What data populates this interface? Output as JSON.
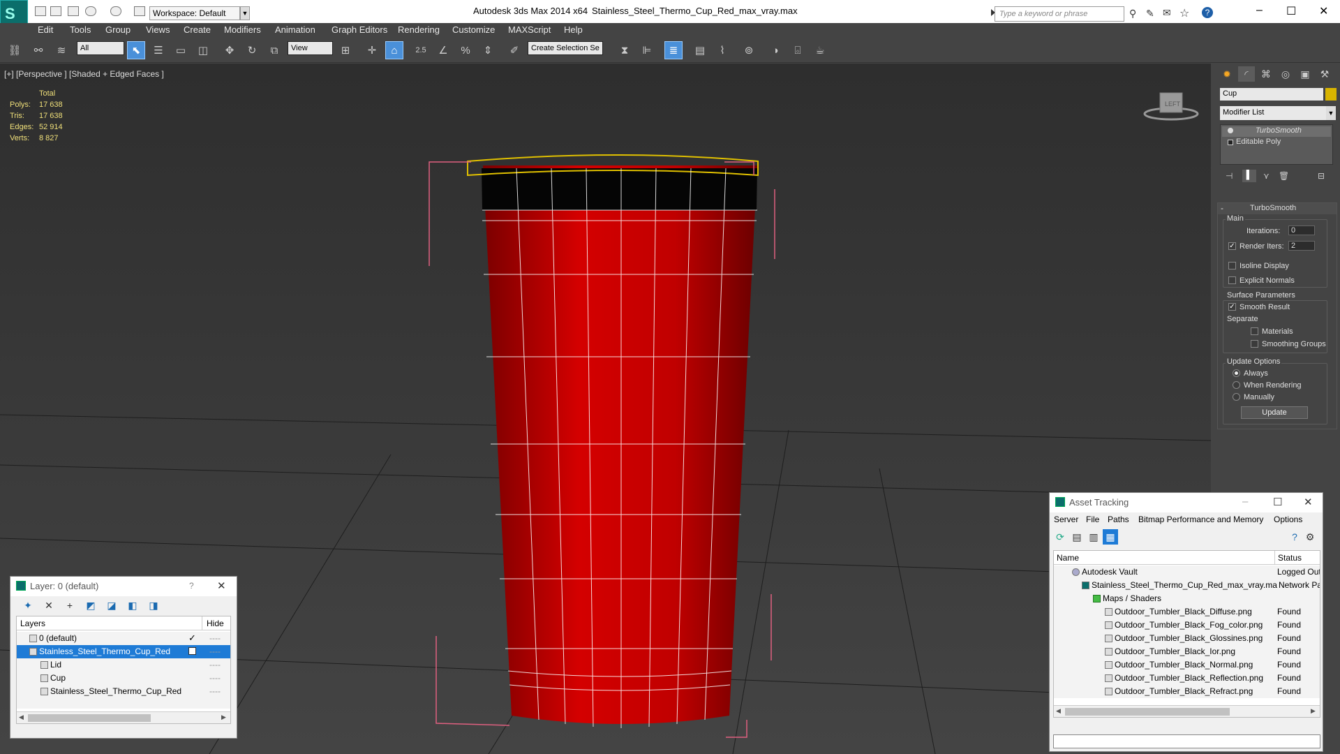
{
  "app": {
    "title": "Autodesk 3ds Max  2014 x64",
    "file": "Stainless_Steel_Thermo_Cup_Red_max_vray.max",
    "workspace": "Workspace: Default",
    "search_placeholder": "Type a keyword or phrase",
    "window_buttons": [
      "–",
      "☐",
      "✕"
    ]
  },
  "menu": [
    "Edit",
    "Tools",
    "Group",
    "Views",
    "Create",
    "Modifiers",
    "Animation",
    "Graph Editors",
    "Rendering",
    "Customize",
    "MAXScript",
    "Help"
  ],
  "toolbar": {
    "filter": "All",
    "ref_coord": "View",
    "snap_label": "2.5",
    "selection_set": "Create Selection Se"
  },
  "viewport": {
    "label": "[+] [Perspective ] [Shaded + Edged Faces ]",
    "stats_header": "Total",
    "stats": [
      {
        "label": "Polys:",
        "value": "17 638"
      },
      {
        "label": "Tris:",
        "value": "17 638"
      },
      {
        "label": "Edges:",
        "value": "52 914"
      },
      {
        "label": "Verts:",
        "value": "8 827"
      }
    ],
    "viewcube_label": "LEFT",
    "colors": {
      "background": "#3a3a3a",
      "cup": "#c80000",
      "wire": "#ffffff",
      "lid": "#e0c000",
      "bbox": "#e06080"
    }
  },
  "command_panel": {
    "object_name": "Cup",
    "object_color": "#d8b400",
    "modifier_list": "Modifier List",
    "stack": [
      {
        "label": "TurboSmooth",
        "selected": true
      },
      {
        "label": "Editable Poly",
        "selected": false
      }
    ],
    "rollout_title": "TurboSmooth",
    "main_group": "Main",
    "iterations_label": "Iterations:",
    "iterations_value": "0",
    "render_iters_label": "Render Iters:",
    "render_iters_value": "2",
    "render_iters_checked": "✓",
    "isoline_label": "Isoline Display",
    "explicit_normals_label": "Explicit Normals",
    "surface_group": "Surface Parameters",
    "smooth_result_label": "Smooth Result",
    "smooth_result_checked": "✓",
    "separate_label": "Separate",
    "materials_label": "Materials",
    "smoothing_groups_label": "Smoothing Groups",
    "update_group": "Update Options",
    "update_options": [
      "Always",
      "When Rendering",
      "Manually"
    ],
    "update_button": "Update",
    "collapse_symbol": "-"
  },
  "layer_window": {
    "title": "Layer: 0 (default)",
    "help": "?",
    "close": "✕",
    "col_layers": "Layers",
    "col_hide": "Hide",
    "rows": [
      {
        "label": "0 (default)",
        "indent": 0,
        "selected": false,
        "hide": "----",
        "check": "✓"
      },
      {
        "label": "Stainless_Steel_Thermo_Cup_Red",
        "indent": 0,
        "selected": true,
        "hide": "----",
        "check": ""
      },
      {
        "label": "Lid",
        "indent": 1,
        "selected": false,
        "hide": "----",
        "check": ""
      },
      {
        "label": "Cup",
        "indent": 1,
        "selected": false,
        "hide": "----",
        "check": ""
      },
      {
        "label": "Stainless_Steel_Thermo_Cup_Red",
        "indent": 1,
        "selected": false,
        "hide": "----",
        "check": ""
      }
    ],
    "scroll_left": "◀",
    "scroll_right": "▶"
  },
  "asset_window": {
    "title": "Asset Tracking",
    "window_buttons": [
      "–",
      "☐",
      "✕"
    ],
    "menu": [
      "Server",
      "File",
      "Paths",
      "Bitmap Performance and Memory",
      "Options"
    ],
    "col_name": "Name",
    "col_status": "Status",
    "rows": [
      {
        "name": "Autodesk Vault",
        "status": "Logged Out",
        "indent": 1
      },
      {
        "name": "Stainless_Steel_Thermo_Cup_Red_max_vray.max",
        "status": "Network Pat",
        "indent": 2
      },
      {
        "name": "Maps / Shaders",
        "status": "",
        "indent": 3
      },
      {
        "name": "Outdoor_Tumbler_Black_Diffuse.png",
        "status": "Found",
        "indent": 4
      },
      {
        "name": "Outdoor_Tumbler_Black_Fog_color.png",
        "status": "Found",
        "indent": 4
      },
      {
        "name": "Outdoor_Tumbler_Black_Glossines.png",
        "status": "Found",
        "indent": 4
      },
      {
        "name": "Outdoor_Tumbler_Black_Ior.png",
        "status": "Found",
        "indent": 4
      },
      {
        "name": "Outdoor_Tumbler_Black_Normal.png",
        "status": "Found",
        "indent": 4
      },
      {
        "name": "Outdoor_Tumbler_Black_Reflection.png",
        "status": "Found",
        "indent": 4
      },
      {
        "name": "Outdoor_Tumbler_Black_Refract.png",
        "status": "Found",
        "indent": 4
      }
    ],
    "scroll_left": "◀",
    "scroll_right": "▶"
  }
}
